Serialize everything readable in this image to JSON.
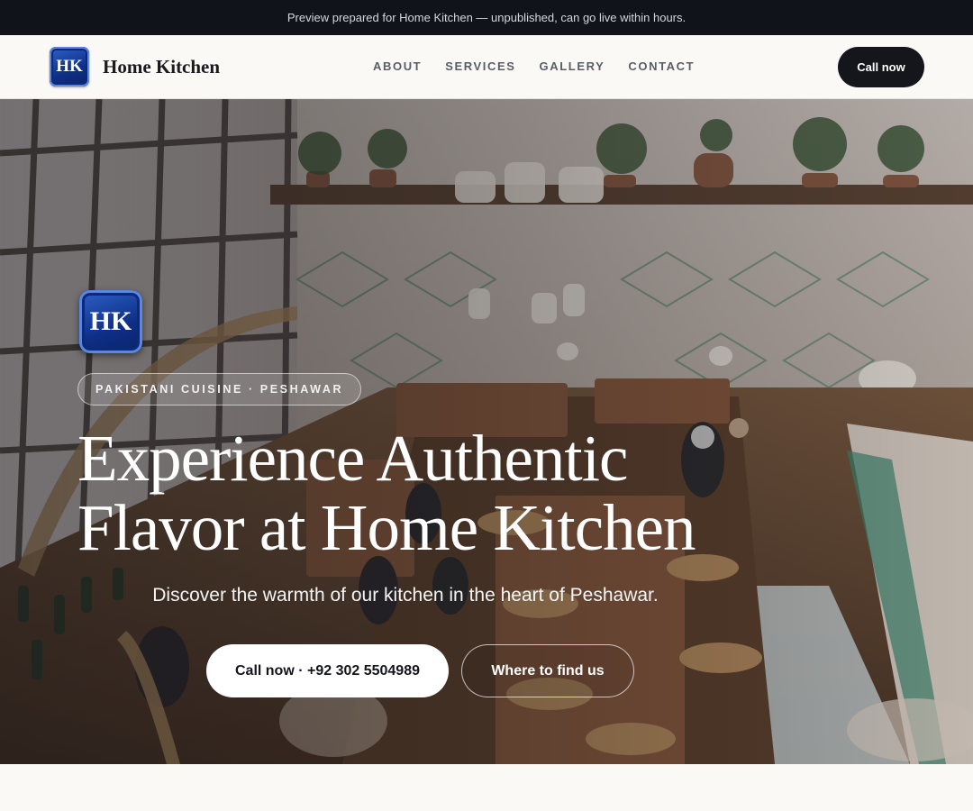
{
  "announcement": "Preview prepared for Home Kitchen — unpublished, can go live within hours.",
  "brand": {
    "logo_text": "HK",
    "name": "Home Kitchen"
  },
  "nav": {
    "items": [
      {
        "label": "ABOUT"
      },
      {
        "label": "SERVICES"
      },
      {
        "label": "GALLERY"
      },
      {
        "label": "CONTACT"
      }
    ],
    "cta_label": "Call now"
  },
  "hero": {
    "logo_text": "HK",
    "tagline": "PAKISTANI CUISINE · PESHAWAR",
    "headline_line1": "Experience Authentic",
    "headline_line2": "Flavor at Home Kitchen",
    "subheadline": "Discover the warmth of our kitchen in the heart of Peshawar.",
    "primary_button": "Call now · +92 302 5504989",
    "secondary_button": "Where to find us"
  },
  "colors": {
    "dark": "#15161c",
    "logo_blue": "#0e2f86",
    "page_bg": "#faf9f6"
  },
  "icons": [
    "hk-logo-badge"
  ]
}
